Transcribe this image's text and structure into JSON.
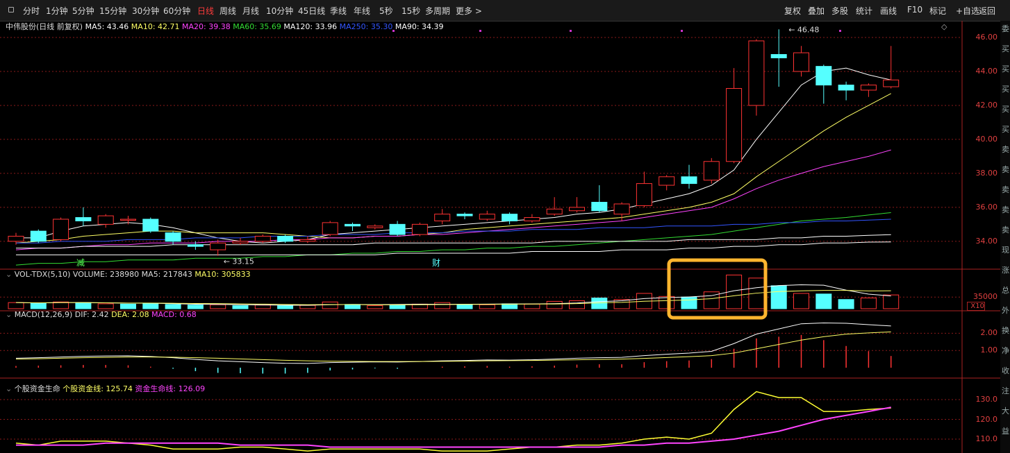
{
  "toolbar": {
    "periods": [
      "分时",
      "1分钟",
      "5分钟",
      "15分钟",
      "30分钟",
      "60分钟",
      "日线",
      "周线",
      "月线",
      "10分钟",
      "45日线",
      "季线",
      "年线",
      "5秒",
      "15秒",
      "多周期",
      "更多 >"
    ],
    "active_period": "日线",
    "actions": [
      "复权",
      "叠加",
      "多股",
      "统计",
      "画线",
      "F10",
      "标记",
      "+自选",
      "返回"
    ],
    "window_controls": [
      "—",
      "□",
      "×"
    ]
  },
  "main_panel": {
    "stock_name": "中伟股份(日线 前复权)",
    "indicators": [
      {
        "label": "MA5: 43.46",
        "color": "#ffffff"
      },
      {
        "label": "MA10: 42.71",
        "color": "#ffff66"
      },
      {
        "label": "MA20: 39.38",
        "color": "#ff44ff"
      },
      {
        "label": "MA60: 35.69",
        "color": "#33dd33"
      },
      {
        "label": "MA120: 33.96",
        "color": "#ffffff"
      },
      {
        "label": "MA250: 35.30",
        "color": "#3355ff"
      },
      {
        "label": "MA90: 34.39",
        "color": "#ffffff"
      }
    ],
    "y_ticks": [
      "46.00",
      "44.00",
      "42.00",
      "40.00",
      "38.00",
      "36.00",
      "34.00"
    ],
    "high_label": "46.48",
    "low_label": "33.15",
    "markers": [
      "减",
      "财"
    ]
  },
  "volume_panel": {
    "title": "VOL-TDX(5,10)",
    "volume": "VOLUME: 238980",
    "ma5": "MA5: 217843",
    "ma10": "MA10: 305833",
    "tick": "35000",
    "scale": "X10"
  },
  "macd_panel": {
    "title": "MACD(12,26,9)",
    "dif": "DIF: 2.42",
    "dea": "DEA: 2.08",
    "macd": "MACD: 0.68",
    "ticks": [
      "2.00",
      "1.00"
    ]
  },
  "fund_panel": {
    "title": "个股资金生命",
    "line1": "个股资金线: 125.74",
    "line2": "资金生命线: 126.09",
    "ticks": [
      "130.0",
      "120.0",
      "110.0"
    ]
  },
  "right_strip": [
    "委",
    "买",
    "买",
    "买",
    "买",
    "买",
    "卖",
    "卖",
    "卖",
    "卖",
    "卖",
    "现",
    "涨",
    "总",
    "外",
    "换",
    "净",
    "收",
    "注",
    "大",
    "益"
  ],
  "candles": [
    {
      "o": 34.0,
      "c": 34.3,
      "h": 34.5,
      "l": 33.8
    },
    {
      "o": 34.6,
      "c": 34.0,
      "h": 34.7,
      "l": 33.9
    },
    {
      "o": 34.1,
      "c": 35.3,
      "h": 35.4,
      "l": 34.0
    },
    {
      "o": 35.4,
      "c": 35.2,
      "h": 36.0,
      "l": 34.9
    },
    {
      "o": 35.0,
      "c": 35.5,
      "h": 35.6,
      "l": 34.8
    },
    {
      "o": 35.3,
      "c": 35.3,
      "h": 35.5,
      "l": 35.0
    },
    {
      "o": 35.3,
      "c": 34.6,
      "h": 35.4,
      "l": 34.5
    },
    {
      "o": 34.5,
      "c": 34.0,
      "h": 34.6,
      "l": 33.8
    },
    {
      "o": 33.8,
      "c": 33.7,
      "h": 34.0,
      "l": 33.5
    },
    {
      "o": 33.5,
      "c": 33.9,
      "h": 34.1,
      "l": 33.15
    },
    {
      "o": 33.9,
      "c": 34.0,
      "h": 34.2,
      "l": 33.8
    },
    {
      "o": 34.0,
      "c": 34.3,
      "h": 34.4,
      "l": 33.9
    },
    {
      "o": 34.3,
      "c": 34.0,
      "h": 34.4,
      "l": 33.9
    },
    {
      "o": 34.0,
      "c": 34.1,
      "h": 34.3,
      "l": 33.9
    },
    {
      "o": 34.4,
      "c": 35.1,
      "h": 35.2,
      "l": 34.3
    },
    {
      "o": 35.0,
      "c": 34.9,
      "h": 35.1,
      "l": 34.6
    },
    {
      "o": 34.8,
      "c": 34.9,
      "h": 35.0,
      "l": 34.7
    },
    {
      "o": 35.0,
      "c": 34.4,
      "h": 35.2,
      "l": 34.3
    },
    {
      "o": 34.4,
      "c": 35.0,
      "h": 35.1,
      "l": 34.3
    },
    {
      "o": 35.2,
      "c": 35.6,
      "h": 35.9,
      "l": 35.0
    },
    {
      "o": 35.6,
      "c": 35.5,
      "h": 35.7,
      "l": 35.3
    },
    {
      "o": 35.3,
      "c": 35.6,
      "h": 35.8,
      "l": 35.2
    },
    {
      "o": 35.6,
      "c": 35.2,
      "h": 35.7,
      "l": 35.0
    },
    {
      "o": 35.2,
      "c": 35.4,
      "h": 35.6,
      "l": 35.1
    },
    {
      "o": 35.6,
      "c": 35.9,
      "h": 36.6,
      "l": 35.5
    },
    {
      "o": 35.8,
      "c": 36.0,
      "h": 36.6,
      "l": 35.7
    },
    {
      "o": 36.3,
      "c": 35.8,
      "h": 37.3,
      "l": 35.7
    },
    {
      "o": 35.6,
      "c": 36.2,
      "h": 36.3,
      "l": 35.2
    },
    {
      "o": 36.1,
      "c": 37.4,
      "h": 38.1,
      "l": 36.0
    },
    {
      "o": 37.3,
      "c": 37.8,
      "h": 37.9,
      "l": 37.0
    },
    {
      "o": 37.8,
      "c": 37.4,
      "h": 38.5,
      "l": 37.1
    },
    {
      "o": 37.6,
      "c": 38.7,
      "h": 38.9,
      "l": 37.4
    },
    {
      "o": 38.7,
      "c": 43.0,
      "h": 44.2,
      "l": 38.6
    },
    {
      "o": 42.0,
      "c": 45.8,
      "h": 45.9,
      "l": 41.4
    },
    {
      "o": 45.0,
      "c": 44.8,
      "h": 46.48,
      "l": 43.1
    },
    {
      "o": 44.0,
      "c": 45.1,
      "h": 45.5,
      "l": 43.7
    },
    {
      "o": 44.3,
      "c": 43.2,
      "h": 44.4,
      "l": 42.1
    },
    {
      "o": 43.2,
      "c": 42.9,
      "h": 43.4,
      "l": 42.3
    },
    {
      "o": 42.9,
      "c": 43.2,
      "h": 43.3,
      "l": 42.5
    },
    {
      "o": 43.1,
      "c": 43.5,
      "h": 45.5,
      "l": 43.0
    }
  ],
  "volumes": [
    {
      "v": 20,
      "up": true
    },
    {
      "v": 18,
      "up": false
    },
    {
      "v": 22,
      "up": true
    },
    {
      "v": 20,
      "up": false
    },
    {
      "v": 16,
      "up": true
    },
    {
      "v": 15,
      "up": false
    },
    {
      "v": 17,
      "up": false
    },
    {
      "v": 14,
      "up": false
    },
    {
      "v": 12,
      "up": false
    },
    {
      "v": 13,
      "up": true
    },
    {
      "v": 10,
      "up": false
    },
    {
      "v": 12,
      "up": true
    },
    {
      "v": 10,
      "up": false
    },
    {
      "v": 11,
      "up": true
    },
    {
      "v": 22,
      "up": true
    },
    {
      "v": 14,
      "up": false
    },
    {
      "v": 10,
      "up": true
    },
    {
      "v": 13,
      "up": false
    },
    {
      "v": 15,
      "up": true
    },
    {
      "v": 20,
      "up": true
    },
    {
      "v": 14,
      "up": false
    },
    {
      "v": 13,
      "up": true
    },
    {
      "v": 16,
      "up": false
    },
    {
      "v": 15,
      "up": true
    },
    {
      "v": 24,
      "up": true
    },
    {
      "v": 26,
      "up": true
    },
    {
      "v": 35,
      "up": false
    },
    {
      "v": 30,
      "up": true
    },
    {
      "v": 50,
      "up": true
    },
    {
      "v": 40,
      "up": true
    },
    {
      "v": 38,
      "up": false
    },
    {
      "v": 55,
      "up": true
    },
    {
      "v": 110,
      "up": true
    },
    {
      "v": 100,
      "up": true
    },
    {
      "v": 75,
      "up": false
    },
    {
      "v": 50,
      "up": true
    },
    {
      "v": 48,
      "up": false
    },
    {
      "v": 30,
      "up": false
    },
    {
      "v": 35,
      "up": true
    },
    {
      "v": 45,
      "up": true
    }
  ],
  "ma_lines": {
    "ma5": [
      34.2,
      34.2,
      34.6,
      34.9,
      35.0,
      35.1,
      35.0,
      34.8,
      34.5,
      34.2,
      34.0,
      33.9,
      34.0,
      34.1,
      34.4,
      34.5,
      34.6,
      34.7,
      34.8,
      34.9,
      35.0,
      35.1,
      35.2,
      35.3,
      35.4,
      35.6,
      35.7,
      35.9,
      36.2,
      36.5,
      36.8,
      37.3,
      38.2,
      40.0,
      41.6,
      43.2,
      44.0,
      44.2,
      43.8,
      43.5
    ],
    "ma10": [
      33.9,
      34.0,
      34.1,
      34.3,
      34.4,
      34.5,
      34.6,
      34.6,
      34.5,
      34.5,
      34.5,
      34.5,
      34.4,
      34.3,
      34.2,
      34.2,
      34.3,
      34.3,
      34.4,
      34.5,
      34.7,
      34.8,
      34.9,
      35.0,
      35.1,
      35.2,
      35.3,
      35.4,
      35.6,
      35.8,
      36.0,
      36.3,
      36.8,
      37.8,
      38.7,
      39.6,
      40.5,
      41.3,
      42.0,
      42.7
    ],
    "ma20": [
      33.5,
      33.6,
      33.6,
      33.7,
      33.8,
      33.8,
      33.9,
      33.9,
      33.9,
      34.0,
      34.0,
      34.0,
      34.1,
      34.1,
      34.2,
      34.2,
      34.3,
      34.3,
      34.4,
      34.4,
      34.5,
      34.6,
      34.7,
      34.8,
      34.9,
      35.0,
      35.1,
      35.2,
      35.4,
      35.6,
      35.8,
      36.0,
      36.5,
      37.1,
      37.6,
      38.0,
      38.4,
      38.7,
      39.0,
      39.38
    ],
    "ma60": [
      32.6,
      32.7,
      32.7,
      32.8,
      32.8,
      32.9,
      32.9,
      32.9,
      33.0,
      33.0,
      33.0,
      33.1,
      33.1,
      33.2,
      33.2,
      33.3,
      33.3,
      33.4,
      33.4,
      33.5,
      33.5,
      33.6,
      33.6,
      33.7,
      33.7,
      33.8,
      33.9,
      34.0,
      34.1,
      34.2,
      34.3,
      34.4,
      34.6,
      34.8,
      35.0,
      35.2,
      35.3,
      35.4,
      35.55,
      35.69
    ],
    "ma120": [
      33.2,
      33.2,
      33.2,
      33.2,
      33.2,
      33.2,
      33.2,
      33.2,
      33.2,
      33.2,
      33.2,
      33.2,
      33.2,
      33.2,
      33.2,
      33.2,
      33.2,
      33.3,
      33.3,
      33.3,
      33.3,
      33.3,
      33.3,
      33.4,
      33.4,
      33.4,
      33.4,
      33.5,
      33.5,
      33.5,
      33.6,
      33.6,
      33.7,
      33.7,
      33.8,
      33.8,
      33.9,
      33.9,
      33.95,
      33.96
    ],
    "ma250": [
      33.9,
      33.9,
      34.0,
      34.0,
      34.0,
      34.1,
      34.1,
      34.1,
      34.2,
      34.2,
      34.2,
      34.3,
      34.3,
      34.3,
      34.4,
      34.4,
      34.4,
      34.5,
      34.5,
      34.5,
      34.6,
      34.6,
      34.6,
      34.7,
      34.7,
      34.7,
      34.8,
      34.8,
      34.8,
      34.9,
      34.9,
      34.9,
      35.0,
      35.0,
      35.1,
      35.1,
      35.2,
      35.2,
      35.25,
      35.3
    ],
    "ma90": [
      33.6,
      33.6,
      33.6,
      33.7,
      33.7,
      33.7,
      33.7,
      33.8,
      33.8,
      33.8,
      33.8,
      33.8,
      33.8,
      33.8,
      33.8,
      33.8,
      33.9,
      33.9,
      33.9,
      33.9,
      33.9,
      33.9,
      33.9,
      33.9,
      34.0,
      34.0,
      34.0,
      34.0,
      34.0,
      34.0,
      34.1,
      34.1,
      34.1,
      34.1,
      34.2,
      34.2,
      34.3,
      34.3,
      34.35,
      34.39
    ]
  },
  "macd_series": {
    "dif": [
      0.55,
      0.58,
      0.62,
      0.66,
      0.68,
      0.69,
      0.65,
      0.58,
      0.48,
      0.4,
      0.35,
      0.3,
      0.26,
      0.25,
      0.3,
      0.32,
      0.34,
      0.33,
      0.36,
      0.4,
      0.42,
      0.45,
      0.44,
      0.46,
      0.5,
      0.55,
      0.58,
      0.6,
      0.7,
      0.78,
      0.85,
      0.95,
      1.4,
      1.95,
      2.25,
      2.55,
      2.6,
      2.58,
      2.5,
      2.42
    ],
    "dea": [
      0.5,
      0.52,
      0.55,
      0.58,
      0.6,
      0.62,
      0.62,
      0.61,
      0.58,
      0.55,
      0.51,
      0.47,
      0.43,
      0.4,
      0.38,
      0.37,
      0.36,
      0.36,
      0.36,
      0.37,
      0.38,
      0.4,
      0.41,
      0.42,
      0.44,
      0.46,
      0.48,
      0.5,
      0.54,
      0.59,
      0.64,
      0.7,
      0.85,
      1.1,
      1.35,
      1.6,
      1.8,
      1.95,
      2.02,
      2.08
    ],
    "bar": [
      0.1,
      0.12,
      0.14,
      0.16,
      0.16,
      0.14,
      0.06,
      -0.06,
      -0.2,
      -0.3,
      -0.32,
      -0.34,
      -0.34,
      -0.3,
      -0.16,
      -0.1,
      -0.04,
      -0.06,
      0.0,
      0.06,
      0.08,
      0.1,
      0.06,
      0.08,
      0.12,
      0.18,
      0.2,
      0.2,
      0.32,
      0.38,
      0.42,
      0.5,
      1.1,
      1.7,
      1.8,
      1.9,
      1.6,
      1.26,
      0.96,
      0.68
    ]
  },
  "fund_series": {
    "line1": [
      108,
      107,
      109,
      109,
      109,
      108,
      107,
      105,
      105,
      105,
      106,
      106,
      105,
      104,
      105,
      105,
      105,
      105,
      105,
      104,
      104,
      104,
      105,
      106,
      106,
      107,
      107,
      108,
      110,
      111,
      110,
      113,
      125,
      134,
      131,
      131,
      124,
      124,
      125,
      125.74
    ],
    "line2": [
      107,
      107,
      107,
      107,
      108,
      108,
      108,
      108,
      108,
      108,
      107,
      107,
      107,
      107,
      106,
      106,
      106,
      106,
      106,
      106,
      106,
      106,
      106,
      106,
      106,
      106,
      106,
      107,
      107,
      108,
      108,
      109,
      110,
      112,
      114,
      117,
      120,
      122,
      124,
      126.09
    ]
  },
  "colors": {
    "up": "#ff3333",
    "down": "#55ffff",
    "grid": "#8b1a1a",
    "highlight": "#ffb52e"
  }
}
